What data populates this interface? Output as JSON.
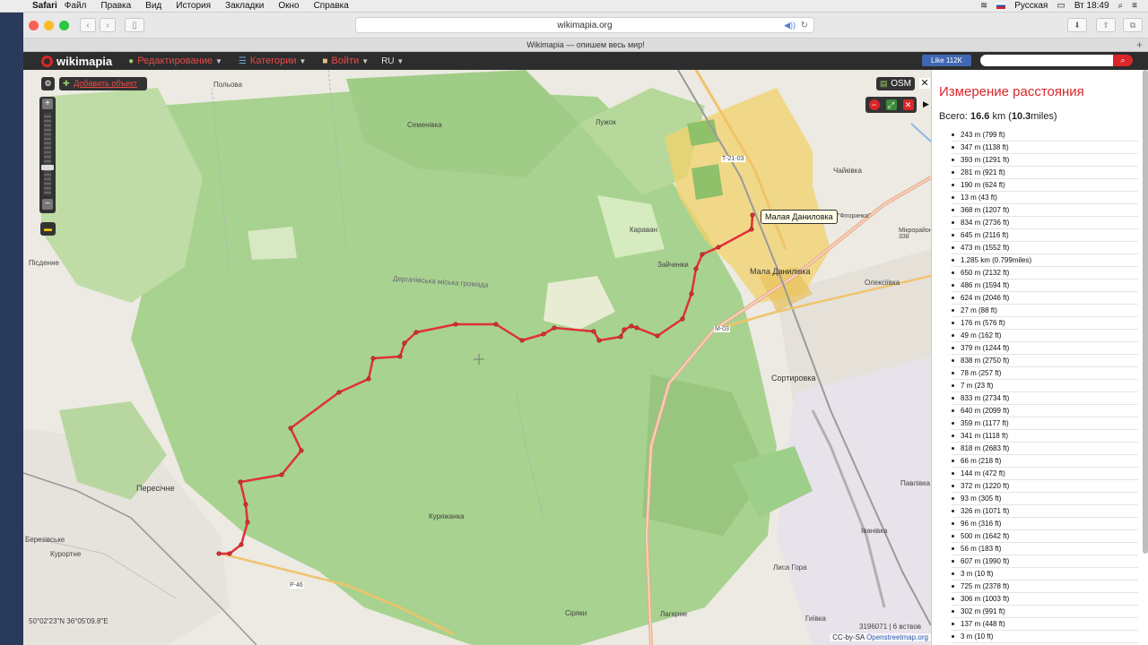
{
  "menubar": {
    "app_name": "Safari",
    "items": [
      "Файл",
      "Правка",
      "Вид",
      "История",
      "Закладки",
      "Окно",
      "Справка"
    ],
    "language": "Русская",
    "clock": "Вт 18:49"
  },
  "browser": {
    "url": "wikimapia.org",
    "tab_title": "Wikimapia — опишем весь мир!"
  },
  "wikimapia_nav": {
    "logo": "wikimapia",
    "menus": [
      "Редактирование",
      "Категории",
      "Войти"
    ],
    "language": "RU",
    "facebook_like": "Like 112K",
    "search_placeholder": ""
  },
  "map": {
    "add_object": "Добавить объект",
    "layer_button": "OSM",
    "tooltip": "Малая Даниловка",
    "coordinates": "50°02'23\"N 36°05'09.8\"E",
    "scale": "3196071 | 6 вствов",
    "attribution_prefix": "CC-by-SA ",
    "attribution_link": "Openstreetmap.org",
    "places": [
      "Польова",
      "Семенівка",
      "Лужок",
      "Чайківка",
      "Караван",
      "Зайченки",
      "Мала Данилівка",
      "Олексіївка",
      "Пісденне",
      "Дергачівська міська громада",
      "Сортировка",
      "Пересічне",
      "Куряжанка",
      "Павлівка",
      "Іванівка",
      "Лиса Гора",
      "Сіряки",
      "Лагерне",
      "Гиївка",
      "Курортне",
      "Березівське",
      "Т-21-03",
      "М-03",
      "Р-46",
      "КМ \"Флоринка\"",
      "Мікрорайон 338"
    ]
  },
  "panel": {
    "title": "Измерение расстояния",
    "total_prefix": "Всего: ",
    "total_km": "16.6",
    "total_km_unit": " km (",
    "total_miles": "10.3",
    "total_miles_unit": "miles)",
    "segments": [
      "243 m (799 ft)",
      "347 m (1138 ft)",
      "393 m (1291 ft)",
      "281 m (921 ft)",
      "190 m (624 ft)",
      "13 m (43 ft)",
      "368 m (1207 ft)",
      "834 m (2736 ft)",
      "645 m (2116 ft)",
      "473 m (1552 ft)",
      "1.285 km (0.799miles)",
      "650 m (2132 ft)",
      "486 m (1594 ft)",
      "624 m (2046 ft)",
      "27 m (88 ft)",
      "176 m (576 ft)",
      "49 m (162 ft)",
      "379 m (1244 ft)",
      "838 m (2750 ft)",
      "78 m (257 ft)",
      "7 m (23 ft)",
      "833 m (2734 ft)",
      "640 m (2099 ft)",
      "359 m (1177 ft)",
      "341 m (1118 ft)",
      "818 m (2683 ft)",
      "66 m (218 ft)",
      "144 m (472 ft)",
      "372 m (1220 ft)",
      "93 m (305 ft)",
      "326 m (1071 ft)",
      "96 m (316 ft)",
      "500 m (1642 ft)",
      "56 m (183 ft)",
      "607 m (1990 ft)",
      "3 m (10 ft)",
      "725 m (2378 ft)",
      "306 m (1003 ft)",
      "302 m (991 ft)",
      "137 m (448 ft)",
      "3 m (10 ft)"
    ]
  },
  "colors": {
    "brand_red": "#d9262a",
    "route": "#e0303a",
    "forest": "#a8d28f",
    "urban_yellow": "#f3d26b"
  }
}
